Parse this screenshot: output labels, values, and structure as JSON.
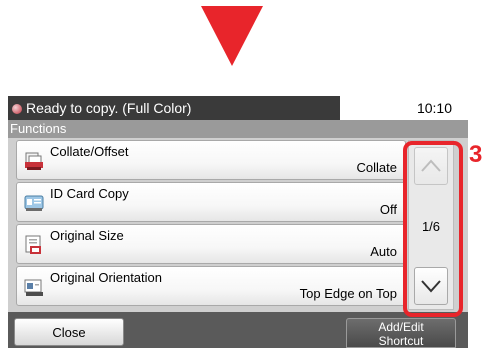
{
  "status": {
    "text": "Ready to copy. (Full Color)",
    "time": "10:10"
  },
  "section_title": "Functions",
  "items": [
    {
      "label": "Collate/Offset",
      "value": "Collate",
      "icon": "collate-icon"
    },
    {
      "label": "ID Card Copy",
      "value": "Off",
      "icon": "id-card-icon"
    },
    {
      "label": "Original Size",
      "value": "Auto",
      "icon": "original-size-icon"
    },
    {
      "label": "Original Orientation",
      "value": "Top Edge on Top",
      "icon": "orientation-icon"
    }
  ],
  "pagination": {
    "page": "1/6"
  },
  "buttons": {
    "close": "Close",
    "add_edit_line1": "Add/Edit",
    "add_edit_line2": "Shortcut"
  },
  "callout": "3",
  "colors": {
    "accent": "#e8252b",
    "status_bar": "#3a3a3a",
    "section_bar": "#9a9a9a"
  }
}
